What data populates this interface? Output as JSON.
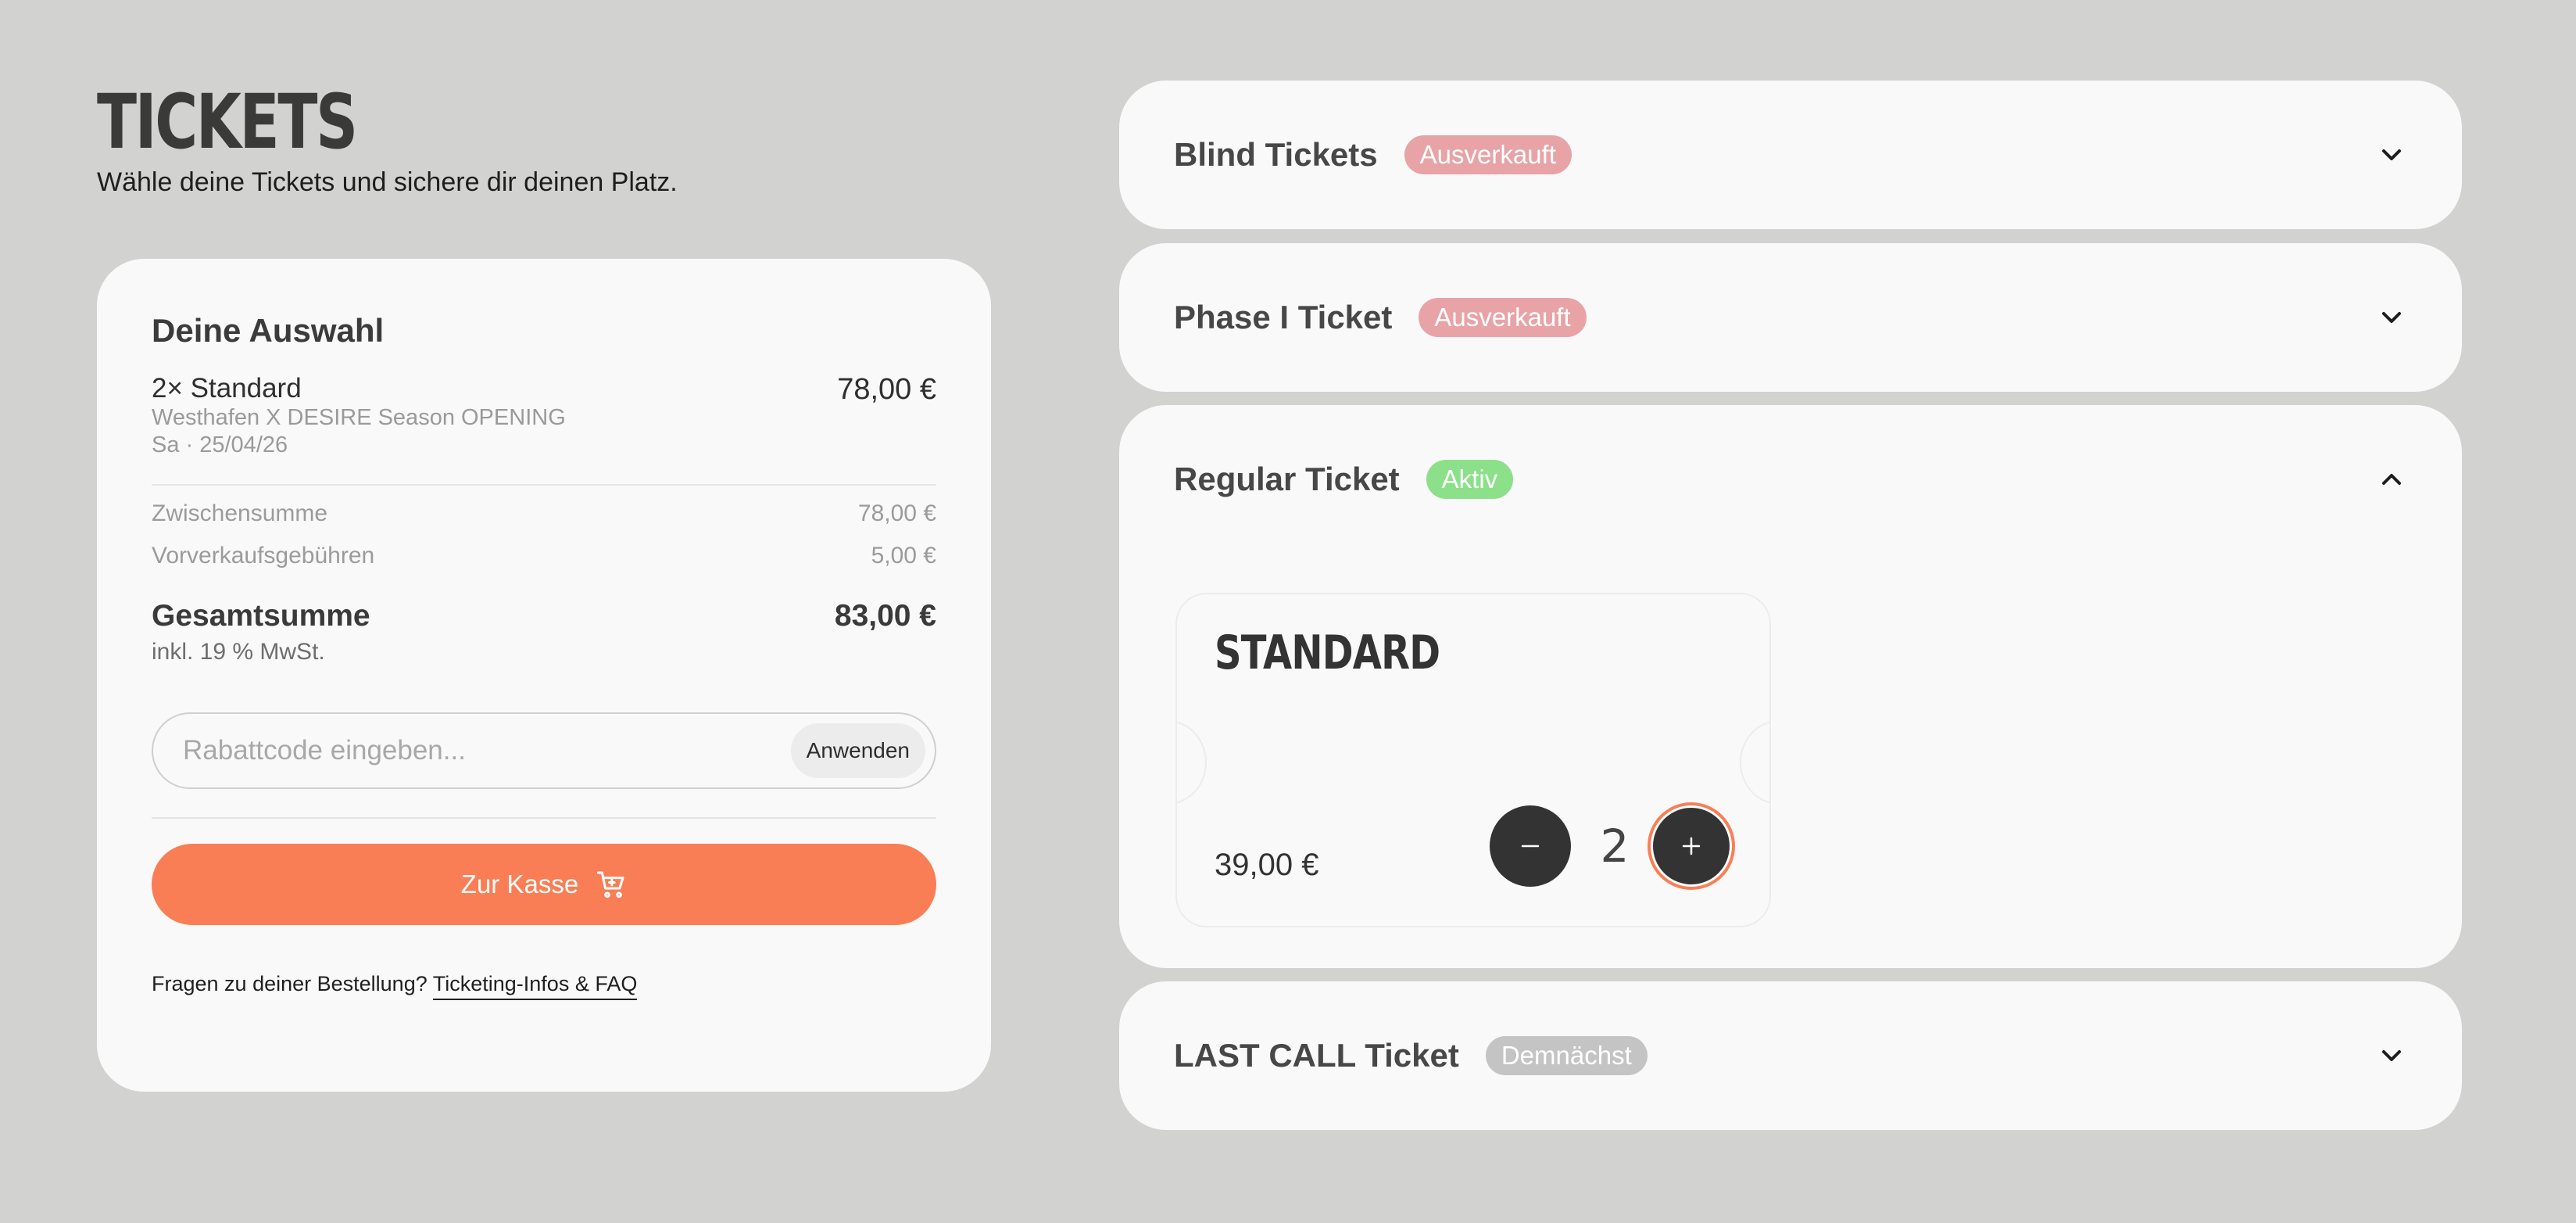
{
  "page": {
    "title": "TICKETS",
    "subtitle": "Wähle deine Tickets und sichere dir deinen Platz."
  },
  "summary": {
    "title": "Deine Auswahl",
    "line_item": {
      "name": "2× Standard",
      "price": "78,00 €",
      "event": "Westhafen X DESIRE Season OPENING",
      "date": "Sa · 25/04/26"
    },
    "subtotal_label": "Zwischensumme",
    "subtotal_value": "78,00 €",
    "fees_label": "Vorverkaufsgebühren",
    "fees_value": "5,00 €",
    "total_label": "Gesamtsumme",
    "total_value": "83,00 €",
    "vat_note": "inkl. 19 % MwSt.",
    "coupon_placeholder": "Rabattcode eingeben...",
    "apply_label": "Anwenden",
    "checkout_label": "Zur Kasse",
    "faq_text": "Fragen zu deiner Bestellung?",
    "faq_link": "Ticketing-Infos & FAQ"
  },
  "tickets": [
    {
      "title": "Blind Tickets",
      "status": "Ausverkauft",
      "status_color": "#e8a3a6",
      "expanded": false
    },
    {
      "title": "Phase I Ticket",
      "status": "Ausverkauft",
      "status_color": "#e8a3a6",
      "expanded": false
    },
    {
      "title": "Regular Ticket",
      "status": "Aktiv",
      "status_color": "#8ce08a",
      "expanded": true,
      "option": {
        "name": "STANDARD",
        "price": "39,00 €",
        "quantity": "2"
      }
    },
    {
      "title": "LAST CALL Ticket",
      "status": "Demnächst",
      "status_color": "#c4c4c4",
      "expanded": false
    }
  ],
  "icons": {
    "chevron_down": "chevron-down-icon",
    "chevron_up": "chevron-up-icon",
    "cart": "cart-icon",
    "minus": "minus-icon",
    "plus": "plus-icon"
  },
  "colors": {
    "accent": "#f97e55",
    "background": "#d2d3d0",
    "card": "#f9f9f9"
  }
}
